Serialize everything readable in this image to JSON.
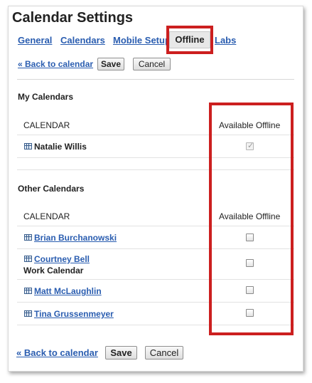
{
  "page": {
    "title": "Calendar Settings"
  },
  "tabs": [
    {
      "label": "General",
      "active": false
    },
    {
      "label": "Calendars",
      "active": false
    },
    {
      "label": "Mobile Setup",
      "active": false
    },
    {
      "label": "Offline",
      "active": true
    },
    {
      "label": "Labs",
      "active": false
    }
  ],
  "actions": {
    "back_label": "« Back to calendar",
    "save_label": "Save",
    "cancel_label": "Cancel"
  },
  "my_calendars": {
    "heading": "My Calendars",
    "col_calendar": "CALENDAR",
    "col_offline": "Available Offline",
    "rows": [
      {
        "name": "Natalie Willis",
        "checked": true,
        "disabled": true
      }
    ]
  },
  "other_calendars": {
    "heading": "Other Calendars",
    "col_calendar": "CALENDAR",
    "col_offline": "Available Offline",
    "rows": [
      {
        "name": "Brian Burchanowski",
        "checked": false
      },
      {
        "name": "Courtney Bell",
        "subtitle": "Work Calendar",
        "checked": false
      },
      {
        "name": "Matt McLaughlin",
        "checked": false
      },
      {
        "name": "Tina Grussenmeyer",
        "checked": false
      }
    ]
  },
  "colors": {
    "link": "#2a5db0",
    "highlight": "#cc1f1f",
    "active_tab_bg": "#e8e8e8"
  },
  "icons": {
    "calendar_row": "calendar-grid-icon",
    "offline_checkbox": "checkbox"
  }
}
